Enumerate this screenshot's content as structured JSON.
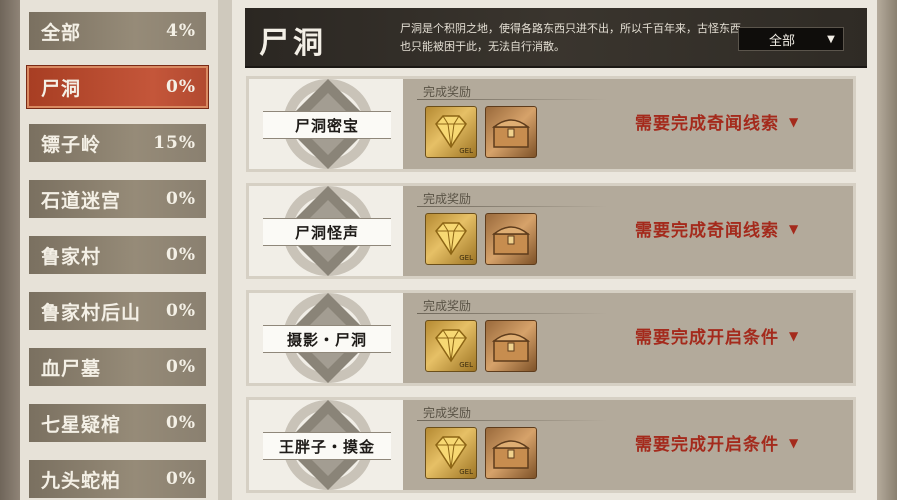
{
  "sidebar": {
    "items": [
      {
        "label": "全部",
        "pct": "4%"
      },
      {
        "label": "尸洞",
        "pct": "0%"
      },
      {
        "label": "镖子岭",
        "pct": "15%"
      },
      {
        "label": "石道迷宫",
        "pct": "0%"
      },
      {
        "label": "鲁家村",
        "pct": "0%"
      },
      {
        "label": "鲁家村后山",
        "pct": "0%"
      },
      {
        "label": "血尸墓",
        "pct": "0%"
      },
      {
        "label": "七星疑棺",
        "pct": "0%"
      },
      {
        "label": "九头蛇柏",
        "pct": "0%"
      }
    ],
    "active_index": 1,
    "active_color": "#b8452b"
  },
  "header": {
    "title": "尸洞",
    "description": "尸洞是个积阴之地，使得各路东西只进不出，所以千百年来，古怪东西也只能被困于此，无法自行消散。",
    "filter": {
      "value": "全部",
      "icon": "triangle-down-icon"
    }
  },
  "quests": [
    {
      "name": "尸洞密宝",
      "reward_label": "完成奖励",
      "rewards": [
        "gold-gem-icon",
        "treasure-chest-icon"
      ],
      "gem_tag": "GEL",
      "status": "需要完成奇闻线索",
      "status_color": "#a42a1c"
    },
    {
      "name": "尸洞怪声",
      "reward_label": "完成奖励",
      "rewards": [
        "gold-gem-icon",
        "treasure-chest-icon"
      ],
      "gem_tag": "GEL",
      "status": "需要完成奇闻线索",
      "status_color": "#a42a1c"
    },
    {
      "name": "摄影・尸洞",
      "reward_label": "完成奖励",
      "rewards": [
        "gold-gem-icon",
        "treasure-chest-icon"
      ],
      "gem_tag": "GEL",
      "status": "需要完成开启条件",
      "status_color": "#a42a1c"
    },
    {
      "name": "王胖子・摸金",
      "reward_label": "完成奖励",
      "rewards": [
        "gold-gem-icon",
        "treasure-chest-icon"
      ],
      "gem_tag": "GEL",
      "status": "需要完成开启条件",
      "status_color": "#a42a1c"
    }
  ]
}
